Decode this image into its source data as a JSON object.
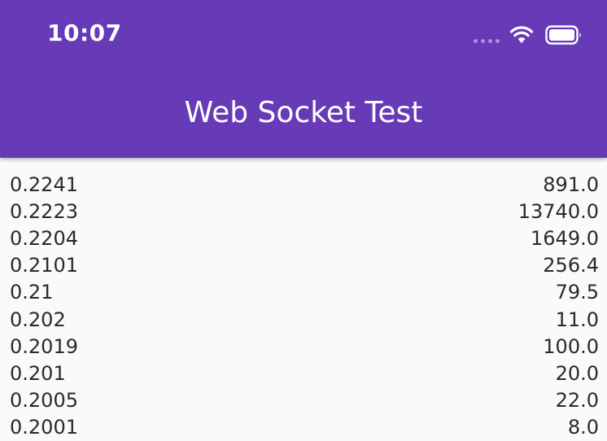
{
  "colors": {
    "accent": "#673ab7"
  },
  "status_bar": {
    "time": "10:07",
    "icons": [
      "signal-dots-icon",
      "wifi-icon",
      "battery-icon"
    ]
  },
  "app_bar": {
    "title": "Web Socket Test"
  },
  "list": {
    "rows": [
      {
        "left": "0.2241",
        "right": "891.0"
      },
      {
        "left": "0.2223",
        "right": "13740.0"
      },
      {
        "left": "0.2204",
        "right": "1649.0"
      },
      {
        "left": "0.2101",
        "right": "256.4"
      },
      {
        "left": "0.21",
        "right": "79.5"
      },
      {
        "left": "0.202",
        "right": "11.0"
      },
      {
        "left": "0.2019",
        "right": "100.0"
      },
      {
        "left": "0.201",
        "right": "20.0"
      },
      {
        "left": "0.2005",
        "right": "22.0"
      },
      {
        "left": "0.2001",
        "right": "8.0"
      }
    ]
  }
}
